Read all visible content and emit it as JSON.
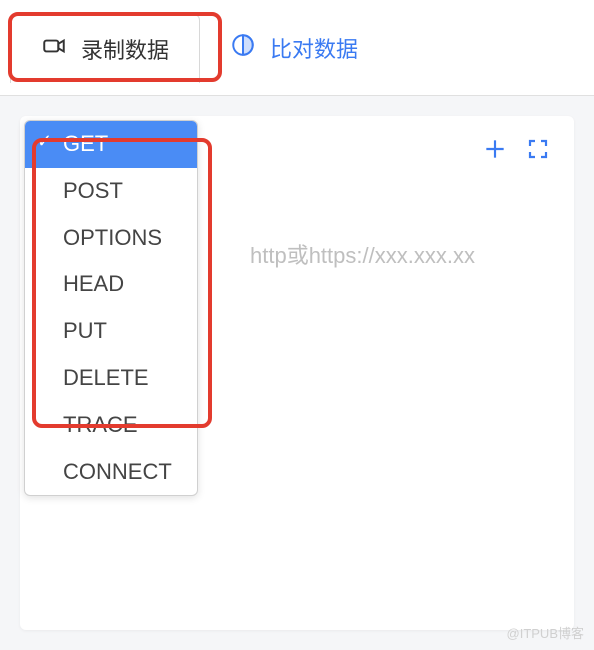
{
  "tabs": {
    "record": {
      "label": "录制数据",
      "icon": "camera-icon"
    },
    "compare": {
      "label": "比对数据",
      "icon": "compare-icon"
    }
  },
  "toolbar": {
    "addLabel": "add",
    "expandLabel": "expand"
  },
  "urlPlaceholder": "http或https://xxx.xxx.xx",
  "httpMethods": [
    {
      "label": "GET",
      "selected": true
    },
    {
      "label": "POST",
      "selected": false
    },
    {
      "label": "OPTIONS",
      "selected": false
    },
    {
      "label": "HEAD",
      "selected": false
    },
    {
      "label": "PUT",
      "selected": false
    },
    {
      "label": "DELETE",
      "selected": false
    },
    {
      "label": "TRACE",
      "selected": false
    },
    {
      "label": "CONNECT",
      "selected": false
    }
  ],
  "colors": {
    "accent": "#3a7af2",
    "highlight": "#e33b2e",
    "selectedBg": "#4a8cf5"
  },
  "watermark": "@ITPUB博客"
}
